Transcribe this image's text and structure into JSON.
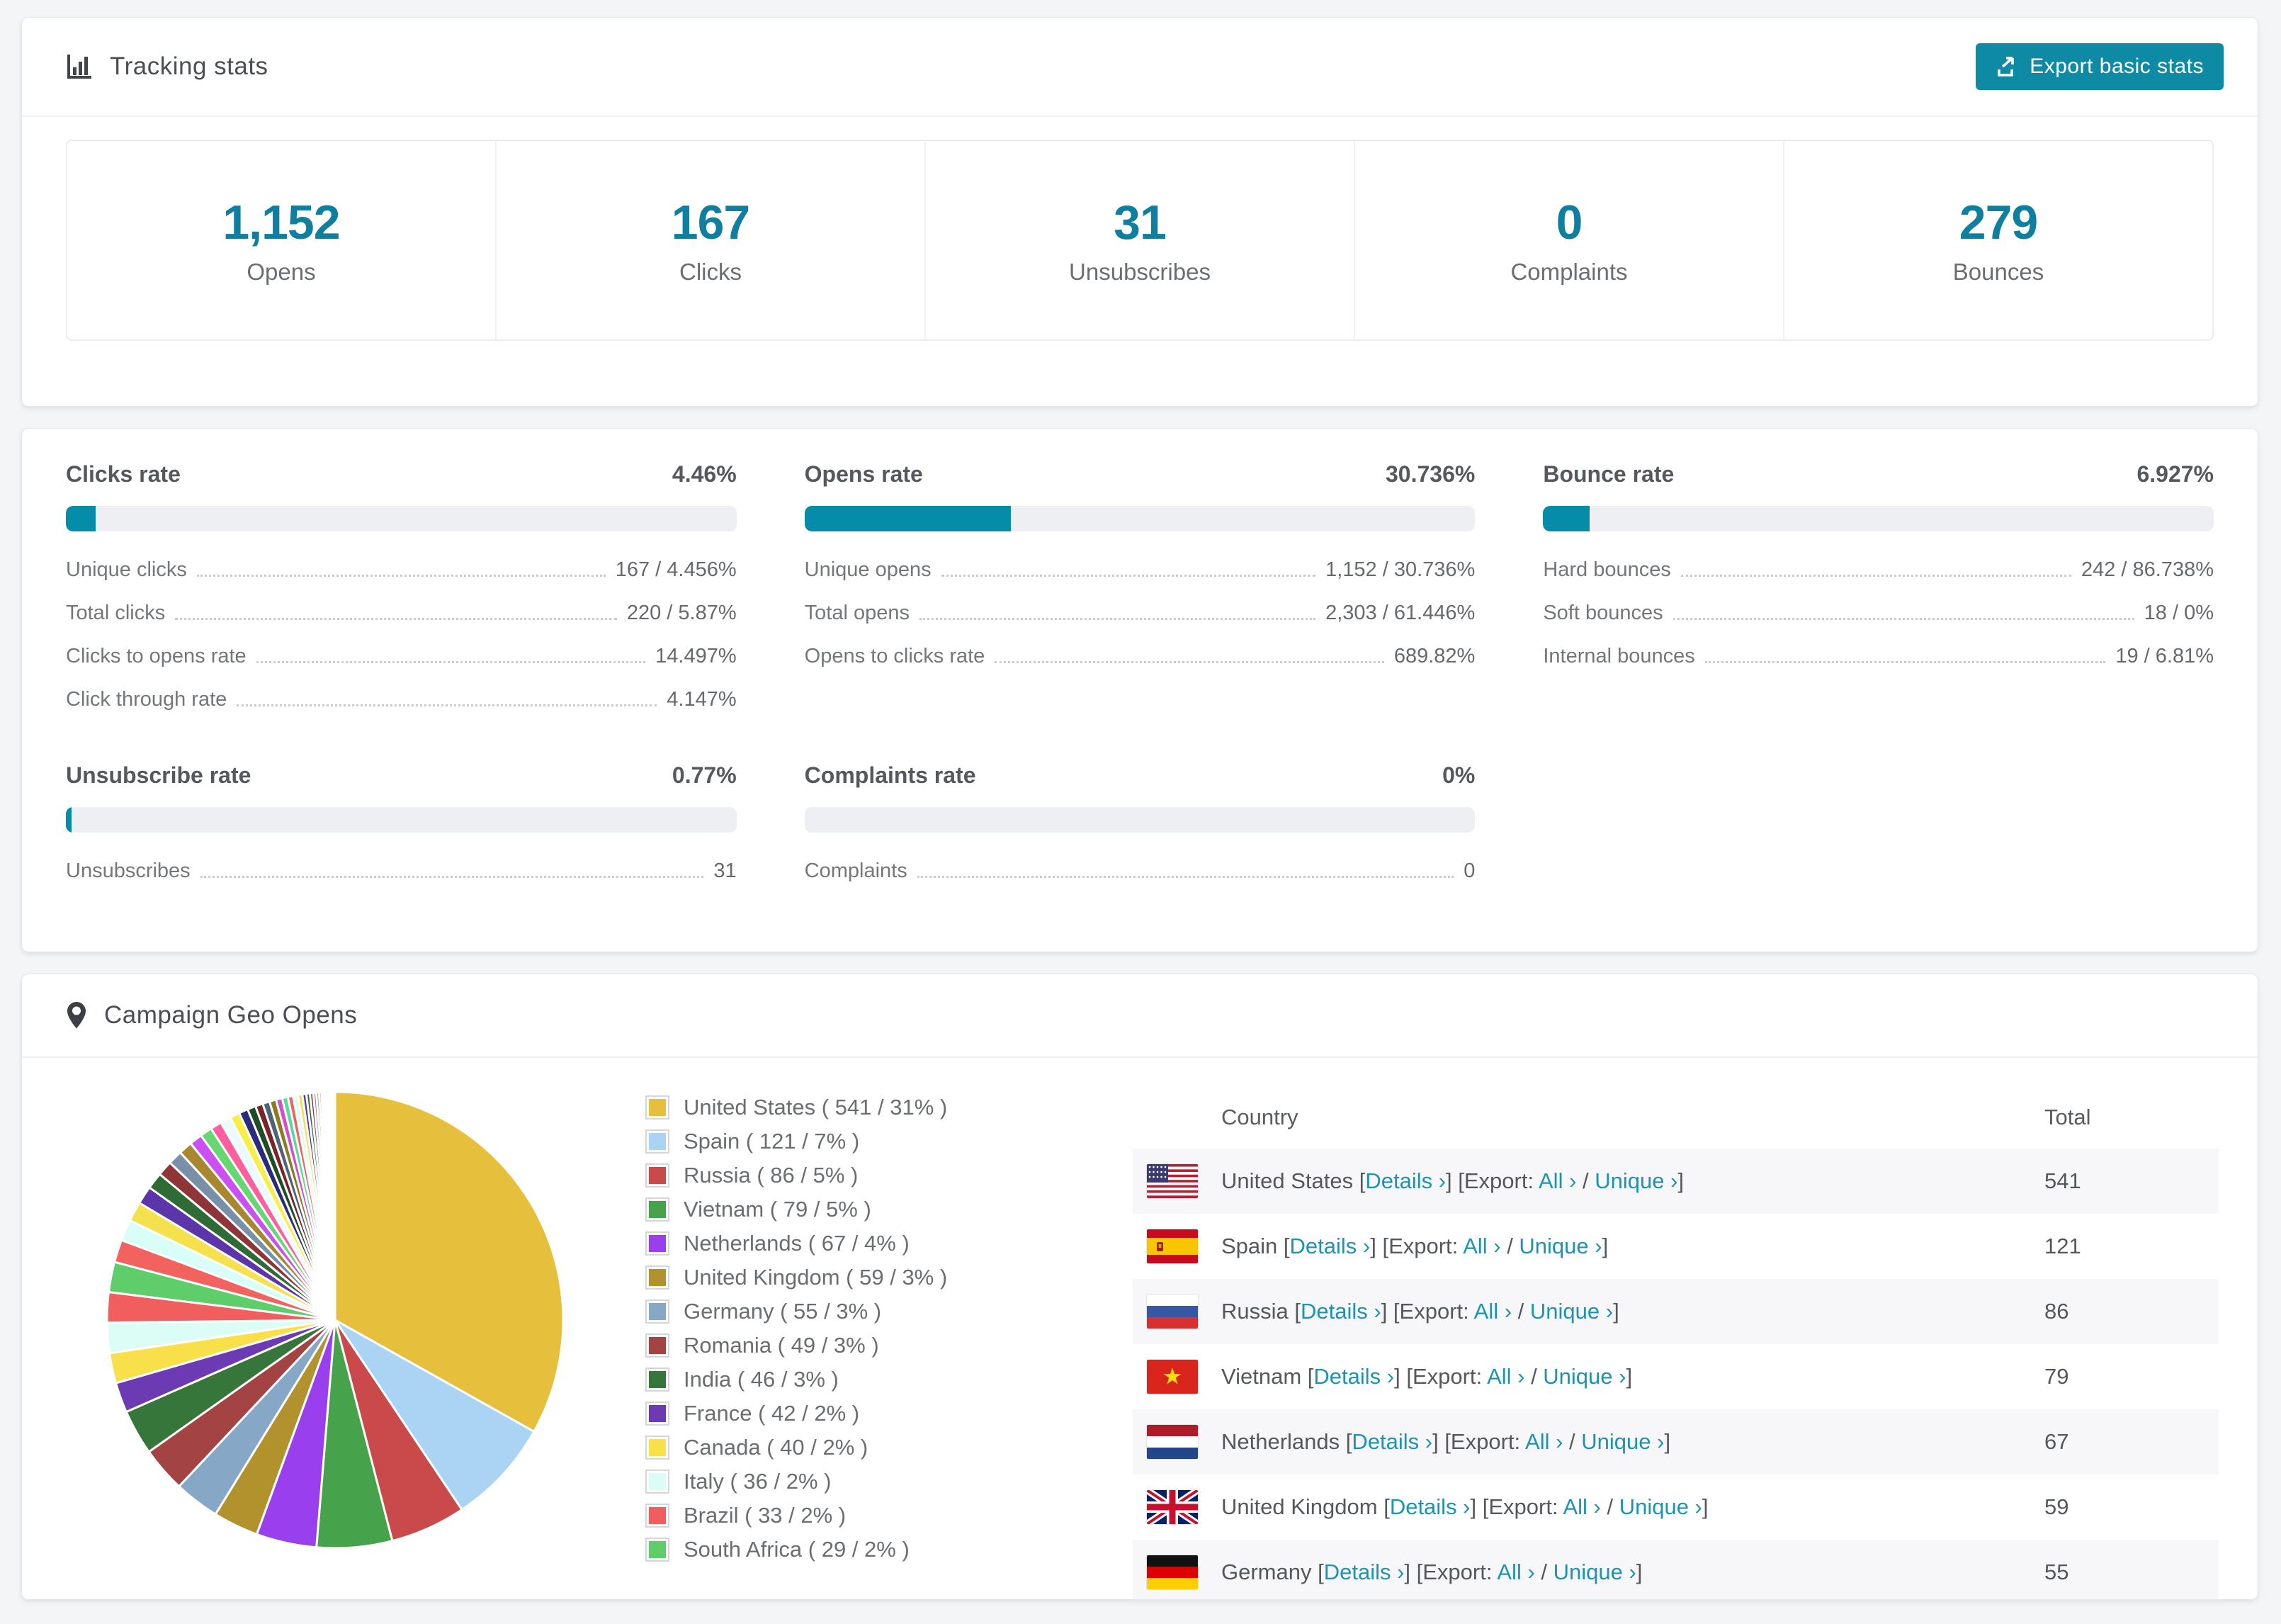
{
  "colors": {
    "accent": "#0e8aa5",
    "bar_fill": "#048ca8",
    "stat_number": "#107e9e",
    "link": "#1d93b2",
    "page_bg": "#f4f5f7",
    "row_stripe": "#f7f7f9"
  },
  "tracking": {
    "title": "Tracking stats",
    "export_label": "Export basic stats",
    "stats": [
      {
        "value": "1,152",
        "label": "Opens"
      },
      {
        "value": "167",
        "label": "Clicks"
      },
      {
        "value": "31",
        "label": "Unsubscribes"
      },
      {
        "value": "0",
        "label": "Complaints"
      },
      {
        "value": "279",
        "label": "Bounces"
      }
    ]
  },
  "rates": [
    {
      "title": "Clicks rate",
      "value": "4.46%",
      "percent": 4.46,
      "rows": [
        {
          "label": "Unique clicks",
          "value": "167 / 4.456%"
        },
        {
          "label": "Total clicks",
          "value": "220 / 5.87%"
        },
        {
          "label": "Clicks to opens rate",
          "value": "14.497%"
        },
        {
          "label": "Click through rate",
          "value": "4.147%"
        }
      ]
    },
    {
      "title": "Opens rate",
      "value": "30.736%",
      "percent": 30.736,
      "rows": [
        {
          "label": "Unique opens",
          "value": "1,152 / 30.736%"
        },
        {
          "label": "Total opens",
          "value": "2,303 / 61.446%"
        },
        {
          "label": "Opens to clicks rate",
          "value": "689.82%"
        }
      ]
    },
    {
      "title": "Bounce rate",
      "value": "6.927%",
      "percent": 6.927,
      "rows": [
        {
          "label": "Hard bounces",
          "value": "242 / 86.738%"
        },
        {
          "label": "Soft bounces",
          "value": "18 / 0%"
        },
        {
          "label": "Internal bounces",
          "value": "19 / 6.81%"
        }
      ]
    },
    {
      "title": "Unsubscribe rate",
      "value": "0.77%",
      "percent": 0.77,
      "rows": [
        {
          "label": "Unsubscribes",
          "value": "31"
        }
      ]
    },
    {
      "title": "Complaints rate",
      "value": "0%",
      "percent": 0,
      "rows": [
        {
          "label": "Complaints",
          "value": "0"
        }
      ]
    }
  ],
  "geo": {
    "title": "Campaign Geo Opens",
    "table": {
      "country_header": "Country",
      "total_header": "Total",
      "details_label": "Details ›",
      "export_prefix": "Export:",
      "all_label": "All ›",
      "unique_label": "Unique ›",
      "rows": [
        {
          "country": "United States",
          "total": "541",
          "flag": "us"
        },
        {
          "country": "Spain",
          "total": "121",
          "flag": "es"
        },
        {
          "country": "Russia",
          "total": "86",
          "flag": "ru"
        },
        {
          "country": "Vietnam",
          "total": "79",
          "flag": "vn"
        },
        {
          "country": "Netherlands",
          "total": "67",
          "flag": "nl"
        },
        {
          "country": "United Kingdom",
          "total": "59",
          "flag": "gb"
        },
        {
          "country": "Germany",
          "total": "55",
          "flag": "de"
        }
      ]
    }
  },
  "chart_data": {
    "type": "pie",
    "title": "Campaign Geo Opens",
    "legend_position": "right",
    "start_angle_deg": -90,
    "direction": "clockwise",
    "slices": [
      {
        "label": "United States",
        "value": 541,
        "pct": 31,
        "color": "#e6c03d"
      },
      {
        "label": "Spain",
        "value": 121,
        "pct": 7,
        "color": "#abd4f4"
      },
      {
        "label": "Russia",
        "value": 86,
        "pct": 5,
        "color": "#ca4a4c"
      },
      {
        "label": "Vietnam",
        "value": 79,
        "pct": 5,
        "color": "#47a34b"
      },
      {
        "label": "Netherlands",
        "value": 67,
        "pct": 4,
        "color": "#9a3fee"
      },
      {
        "label": "United Kingdom",
        "value": 59,
        "pct": 3,
        "color": "#b2922c"
      },
      {
        "label": "Germany",
        "value": 55,
        "pct": 3,
        "color": "#87a7c6"
      },
      {
        "label": "Romania",
        "value": 49,
        "pct": 3,
        "color": "#a34343"
      },
      {
        "label": "India",
        "value": 46,
        "pct": 3,
        "color": "#37763a"
      },
      {
        "label": "France",
        "value": 42,
        "pct": 2,
        "color": "#6c3bb4"
      },
      {
        "label": "Canada",
        "value": 40,
        "pct": 2,
        "color": "#f8e04a"
      },
      {
        "label": "Italy",
        "value": 36,
        "pct": 2,
        "color": "#dcfdf6"
      },
      {
        "label": "Brazil",
        "value": 33,
        "pct": 2,
        "color": "#f05f5e"
      },
      {
        "label": "South Africa",
        "value": 29,
        "pct": 2,
        "color": "#5fcd69"
      }
    ],
    "other_slices": [
      {
        "v": 1.5,
        "c": "#f2635f"
      },
      {
        "v": 1.4,
        "c": "#d9fdf7"
      },
      {
        "v": 1.3,
        "c": "#f5e04d"
      },
      {
        "v": 1.2,
        "c": "#5b35a9"
      },
      {
        "v": 1.1,
        "c": "#2f6b35"
      },
      {
        "v": 1.0,
        "c": "#8f3438"
      },
      {
        "v": 0.95,
        "c": "#7891a9"
      },
      {
        "v": 0.9,
        "c": "#a8882e"
      },
      {
        "v": 0.85,
        "c": "#cb4ff2"
      },
      {
        "v": 0.8,
        "c": "#66d873"
      },
      {
        "v": 0.75,
        "c": "#ff5f9e"
      },
      {
        "v": 0.7,
        "c": "#eafcff"
      },
      {
        "v": 0.65,
        "c": "#f7ef45"
      },
      {
        "v": 0.6,
        "c": "#2b2b7d"
      },
      {
        "v": 0.55,
        "c": "#1e4d23"
      },
      {
        "v": 0.5,
        "c": "#7c2327"
      },
      {
        "v": 0.47,
        "c": "#4e6476"
      },
      {
        "v": 0.44,
        "c": "#8c7c20"
      },
      {
        "v": 0.41,
        "c": "#d44dd0"
      },
      {
        "v": 0.38,
        "c": "#57d9a0"
      },
      {
        "v": 0.35,
        "c": "#f2635f"
      },
      {
        "v": 0.32,
        "c": "#d9fdf7"
      },
      {
        "v": 0.29,
        "c": "#f5e04d"
      },
      {
        "v": 0.26,
        "c": "#5b35a9"
      },
      {
        "v": 0.24,
        "c": "#2f6b35"
      },
      {
        "v": 0.22,
        "c": "#8f3438"
      },
      {
        "v": 0.2,
        "c": "#7891a9"
      },
      {
        "v": 0.18,
        "c": "#a8882e"
      },
      {
        "v": 0.16,
        "c": "#cb4ff2"
      },
      {
        "v": 0.14,
        "c": "#66d873"
      },
      {
        "v": 0.12,
        "c": "#ff5f9e"
      },
      {
        "v": 0.11,
        "c": "#eafcff"
      },
      {
        "v": 0.1,
        "c": "#f7ef45"
      },
      {
        "v": 0.09,
        "c": "#2b2b7d"
      },
      {
        "v": 0.08,
        "c": "#1e4d23"
      },
      {
        "v": 0.07,
        "c": "#7c2327"
      },
      {
        "v": 0.06,
        "c": "#4e6476"
      },
      {
        "v": 0.05,
        "c": "#8c7c20"
      },
      {
        "v": 0.04,
        "c": "#d44dd0"
      },
      {
        "v": 0.03,
        "c": "#57d9a0"
      }
    ]
  }
}
